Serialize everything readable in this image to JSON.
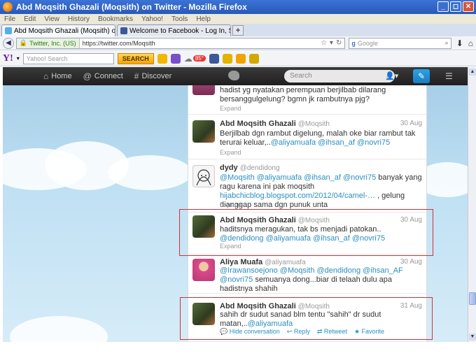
{
  "window": {
    "title": "Abd Moqsith Ghazali (Moqsith) on Twitter - Mozilla Firefox",
    "buttons": [
      "_",
      "◻",
      "✕"
    ]
  },
  "menu": [
    "File",
    "Edit",
    "View",
    "History",
    "Bookmarks",
    "Yahoo!",
    "Tools",
    "Help"
  ],
  "tabs": [
    {
      "label": "Abd Moqsith Ghazali (Moqsith) on Twitter",
      "active": true,
      "favicon_color": "#55acee"
    },
    {
      "label": "Welcome to Facebook - Log In, Sign Up o...",
      "active": false,
      "favicon_color": "#3b5998"
    }
  ],
  "newtab_label": "+",
  "nav": {
    "identity": "Twitter, Inc. (US)",
    "url": "https://twitter.com/Moqsith",
    "search_placeholder": "Google",
    "search_engine": "g"
  },
  "yahoo": {
    "logo": "Y!",
    "search_placeholder": "Yahoo! Search",
    "search_button": "SEARCH",
    "weather_badge": "85°"
  },
  "twitter": {
    "home": "Home",
    "connect": "Connect",
    "discover": "Discover",
    "search_placeholder": "Search"
  },
  "tweets": [
    {
      "name": "",
      "handle": "",
      "date": "",
      "text": "hadist yg nyatakan perempuan berjilbab dilarang bersanggulgelung? bgmn jk rambutnya pjg?",
      "expand": "Expand"
    },
    {
      "name": "Abd Moqsith Ghazali",
      "handle": "@Moqsith",
      "date": "30 Aug",
      "text": "Berjilbab dgn rambut digelung, malah oke biar rambut tak terurai keluar,..",
      "mentions": "@aliyamuafa @ihsan_af @novri75",
      "expand": "Expand"
    },
    {
      "name": "dydy",
      "handle": "@dendidong",
      "date": "30 Aug",
      "mentions_lead": "@Moqsith @aliyamuafa @ihsan_af @novri75",
      "text": " banyak yang ragu karena ini pak moqsith ",
      "link": "hijabchicblog.blogspot.com/2012/04/camel-…",
      "text_tail": " , gelung dianggap sama dgn punuk unta",
      "expand": "Expand"
    },
    {
      "name": "Abd Moqsith Ghazali",
      "handle": "@Moqsith",
      "date": "30 Aug",
      "text": "haditsnya meragukan, tak bs menjadi patokan.. ",
      "mentions": "@dendidong @aliyamuafa @ihsan_af @novri75",
      "expand": "Expand"
    },
    {
      "name": "Aliya Muafa",
      "handle": "@aliyamuafa",
      "date": "30 Aug",
      "mentions_lead": "@Irawansoejono @Moqsith @dendidong @ihsan_AF @novri75",
      "text": "semuanya dong...biar di telaah dulu apa hadistnya shahih"
    },
    {
      "name": "Abd Moqsith Ghazali",
      "handle": "@Moqsith",
      "date": "31 Aug",
      "text": "sahih dr sudut sanad blm tentu \"sahih\" dr sudut matan,..",
      "mentions": "@aliyamuafa",
      "actions": [
        "Hide conversation",
        "Reply",
        "Retweet",
        "Favorite"
      ]
    }
  ],
  "colors": {
    "highlight": "#d0303a",
    "mention": "#2a8fc0",
    "compose": "#1b7cc0"
  }
}
